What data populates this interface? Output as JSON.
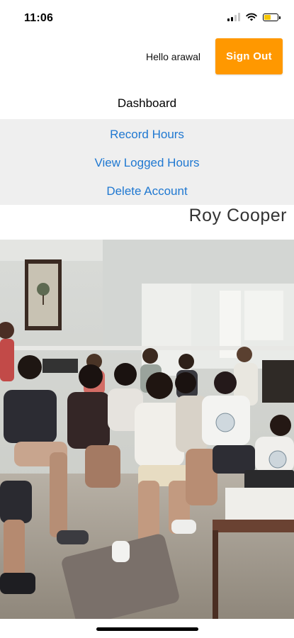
{
  "status_bar": {
    "time": "11:06"
  },
  "header": {
    "greeting": "Hello arawal",
    "sign_out_label": "Sign Out"
  },
  "dashboard": {
    "title": "Dashboard",
    "menu": [
      "Record Hours",
      "View Logged Hours",
      "Delete Account"
    ]
  },
  "profile": {
    "name": "Roy Cooper"
  },
  "colors": {
    "accent": "#ff9800",
    "link": "#1f78d1",
    "menu_bg": "#efefef"
  }
}
